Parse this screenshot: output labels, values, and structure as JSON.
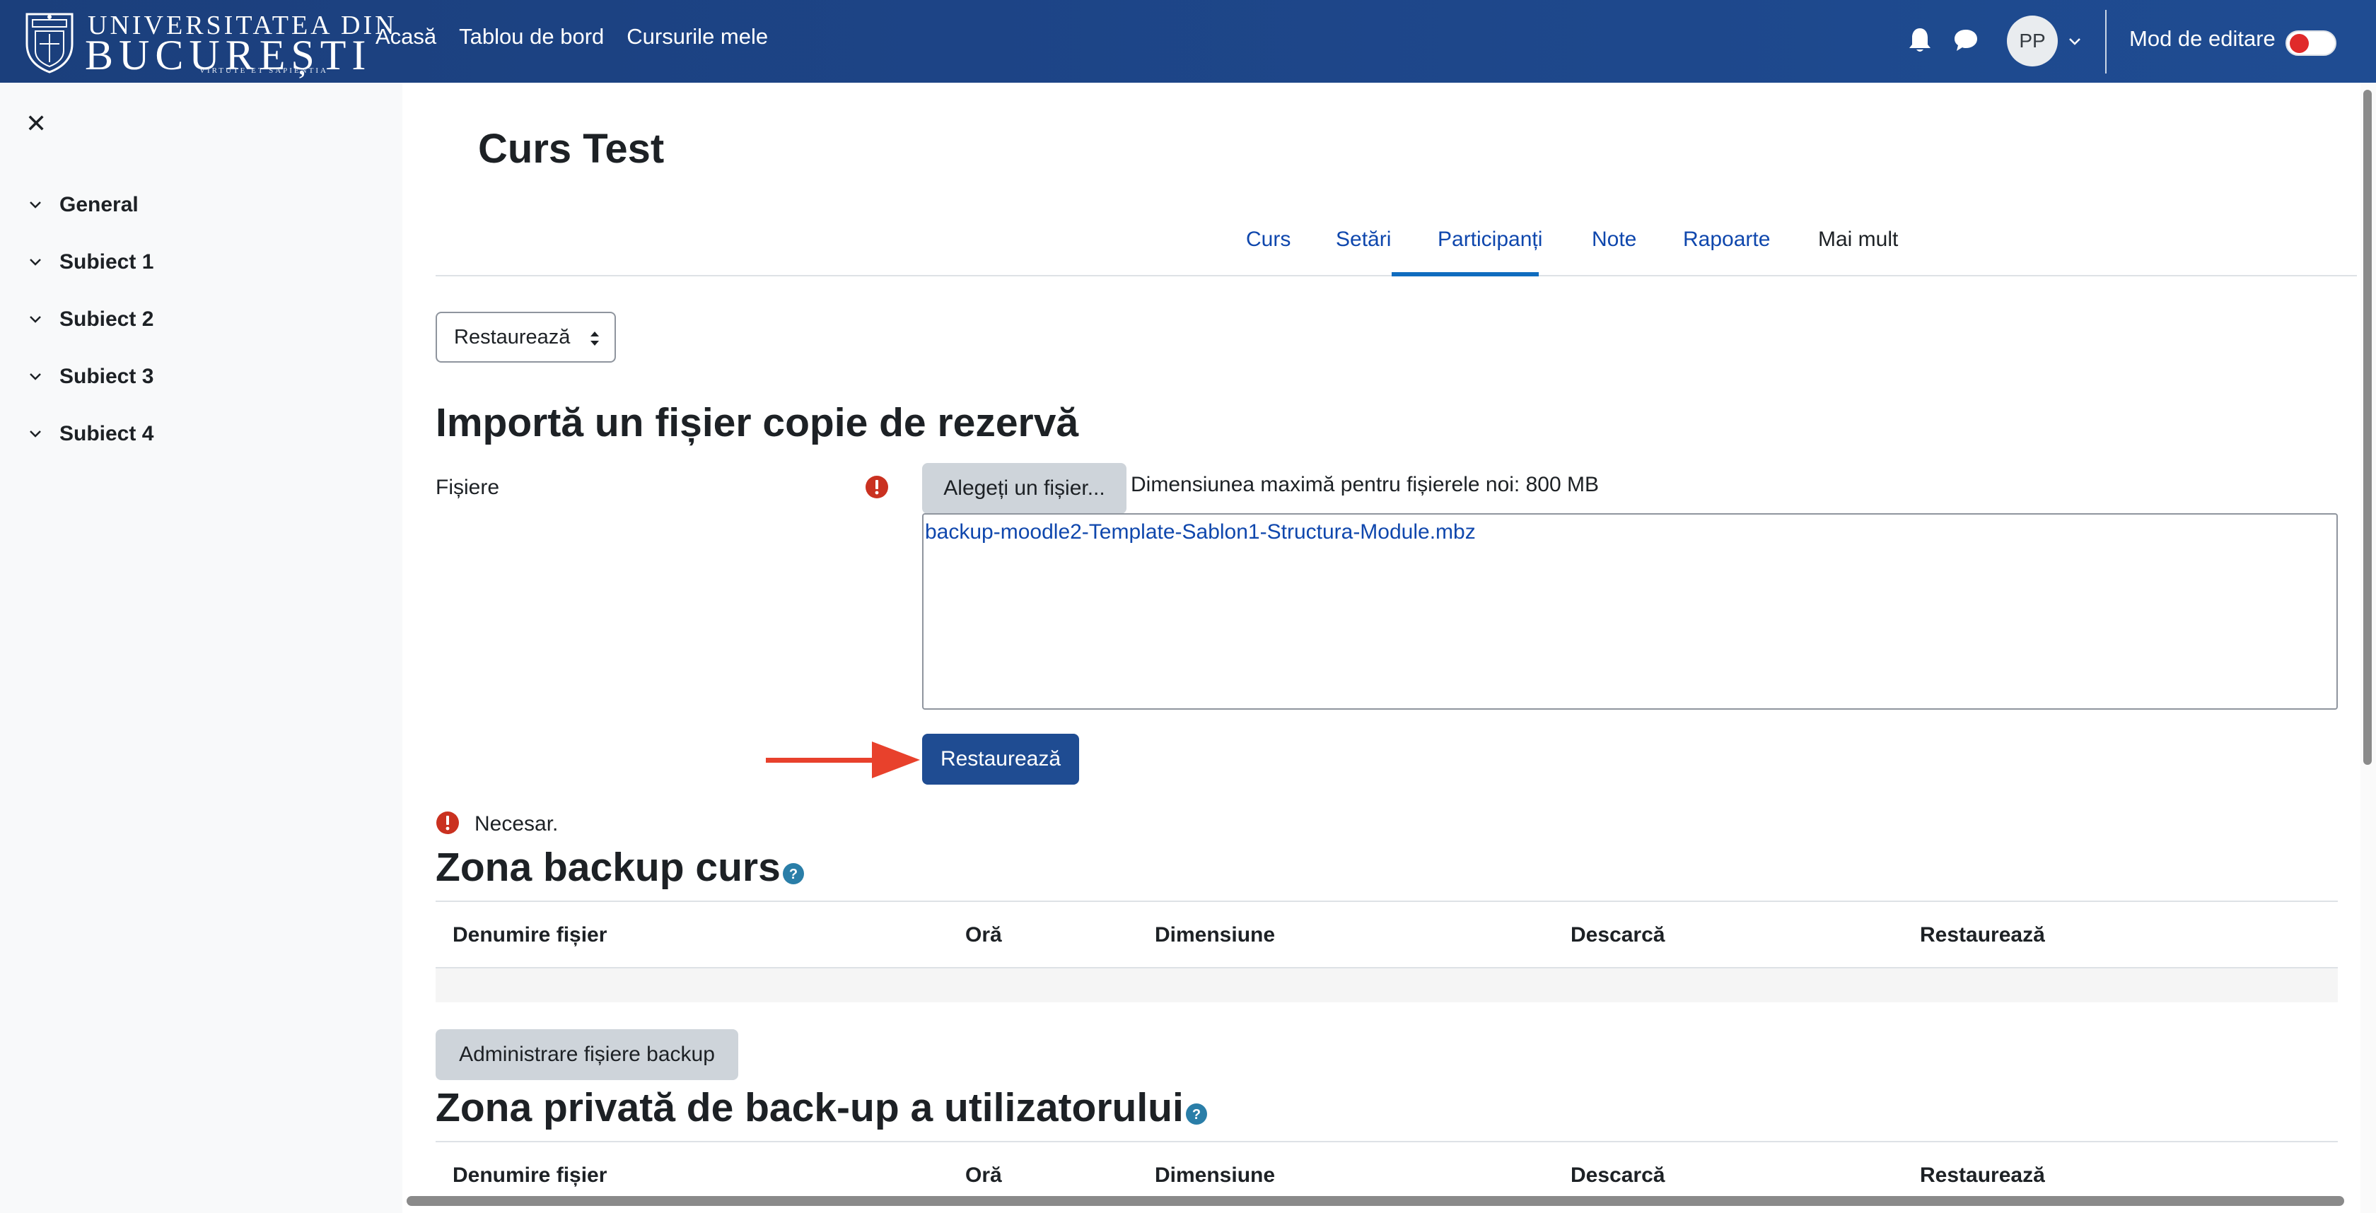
{
  "header": {
    "logo": {
      "line1": "UNIVERSITATEA DIN",
      "line2": "BUCUREȘTI",
      "motto": "VIRTUTE ET SAPIENTIA"
    },
    "nav": [
      {
        "label": "Acasă"
      },
      {
        "label": "Tablou de bord"
      },
      {
        "label": "Cursurile mele"
      }
    ],
    "avatar_initials": "PP",
    "edit_mode_label": "Mod de editare",
    "edit_mode_on": false
  },
  "drawer": {
    "close_symbol": "✕",
    "sections": [
      {
        "label": "General"
      },
      {
        "label": "Subiect 1"
      },
      {
        "label": "Subiect 2"
      },
      {
        "label": "Subiect 3"
      },
      {
        "label": "Subiect 4"
      }
    ]
  },
  "course": {
    "title": "Curs Test",
    "tabs": [
      {
        "label": "Curs"
      },
      {
        "label": "Setări"
      },
      {
        "label": "Participanți"
      },
      {
        "label": "Note"
      },
      {
        "label": "Rapoarte"
      },
      {
        "label": "Mai mult",
        "active": true
      }
    ]
  },
  "restore": {
    "select_value": "Restaurează",
    "import_heading": "Importă un fișier copie de rezervă",
    "files_label": "Fișiere",
    "choose_button": "Alegeți un fișier...",
    "max_size_text": "Dimensiunea maximă pentru fișierele noi: 800 MB",
    "selected_file": "backup-moodle2-Template-Sablon1-Structura-Module.mbz",
    "restore_button": "Restaurează",
    "required_note": "Necesar."
  },
  "course_backup_zone": {
    "heading": "Zona backup curs",
    "columns": [
      "Denumire fișier",
      "Oră",
      "Dimensiune",
      "Descarcă",
      "Restaurează"
    ],
    "rows": [],
    "manage_button": "Administrare fișiere backup"
  },
  "user_backup_zone": {
    "heading": "Zona privată de back-up a utilizatorului",
    "columns": [
      "Denumire fișier",
      "Oră",
      "Dimensiune",
      "Descarcă",
      "Restaurează"
    ]
  },
  "colors": {
    "navbar": "#1d4486",
    "primary_button": "#1f4c92",
    "link": "#0f47ad",
    "required": "#ca3120",
    "help": "#2a7ea8",
    "annotation_arrow": "#e8412c"
  },
  "icons": {
    "bell": "bell-icon",
    "chat": "chat-bubble-icon",
    "close": "close-icon",
    "chevron": "chevron-down-icon",
    "required": "exclamation-circle-icon",
    "help": "question-circle-icon"
  }
}
